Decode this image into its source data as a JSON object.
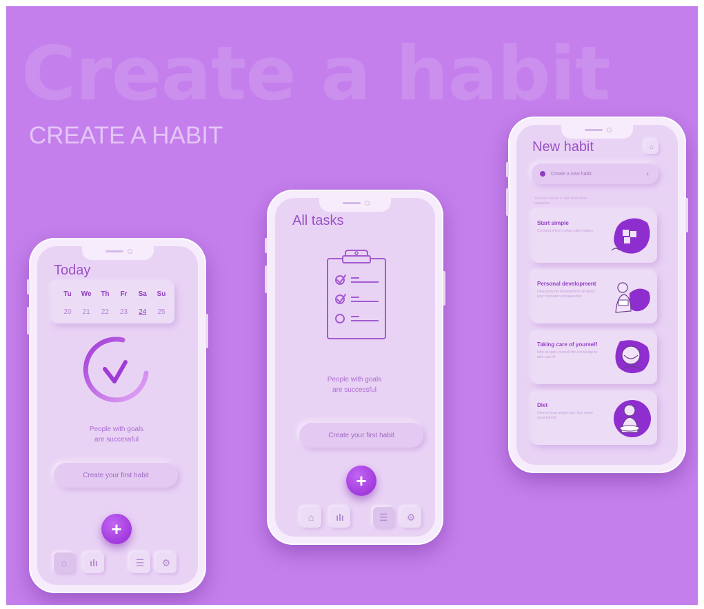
{
  "hero": {
    "title": "Create a habit",
    "subtitle": "CREATE A HABIT"
  },
  "colors": {
    "background": "#c47fec",
    "accent": "#9427d4",
    "screen": "#e9d3f5",
    "frame": "#f6ecfb"
  },
  "today_screen": {
    "title": "Today",
    "days": [
      "Tu",
      "We",
      "Th",
      "Fr",
      "Sa",
      "Su"
    ],
    "dates": [
      "20",
      "21",
      "22",
      "23",
      "24",
      "25"
    ],
    "selected_date": "24",
    "motto_line1": "People with goals",
    "motto_line2": "are successful",
    "cta": "Create your first habit",
    "fab": "+",
    "tabs": [
      "home-icon",
      "chart-icon",
      "list-icon",
      "gear-icon"
    ]
  },
  "tasks_screen": {
    "title": "All tasks",
    "motto_line1": "People with goals",
    "motto_line2": "are successful",
    "cta": "Create your first habit",
    "fab": "+",
    "tabs": [
      "home-icon",
      "chart-icon",
      "list-icon",
      "gear-icon"
    ]
  },
  "new_habit_screen": {
    "title": "New habit",
    "create_row": "Create a new habit",
    "hint_line1": "You can choose a habit from these",
    "hint_line2": "categories",
    "cards": [
      {
        "title": "Start simple",
        "desc": "Constant effort is what really matters"
      },
      {
        "title": "Personal development",
        "desc": "Daily personal development. All about your motivation and passions"
      },
      {
        "title": "Taking care of yourself",
        "desc": "Why not give yourself the knowledge to take care of"
      },
      {
        "title": "Diet",
        "desc": "Care to keep weight loss. Can mean great benefit"
      }
    ]
  }
}
